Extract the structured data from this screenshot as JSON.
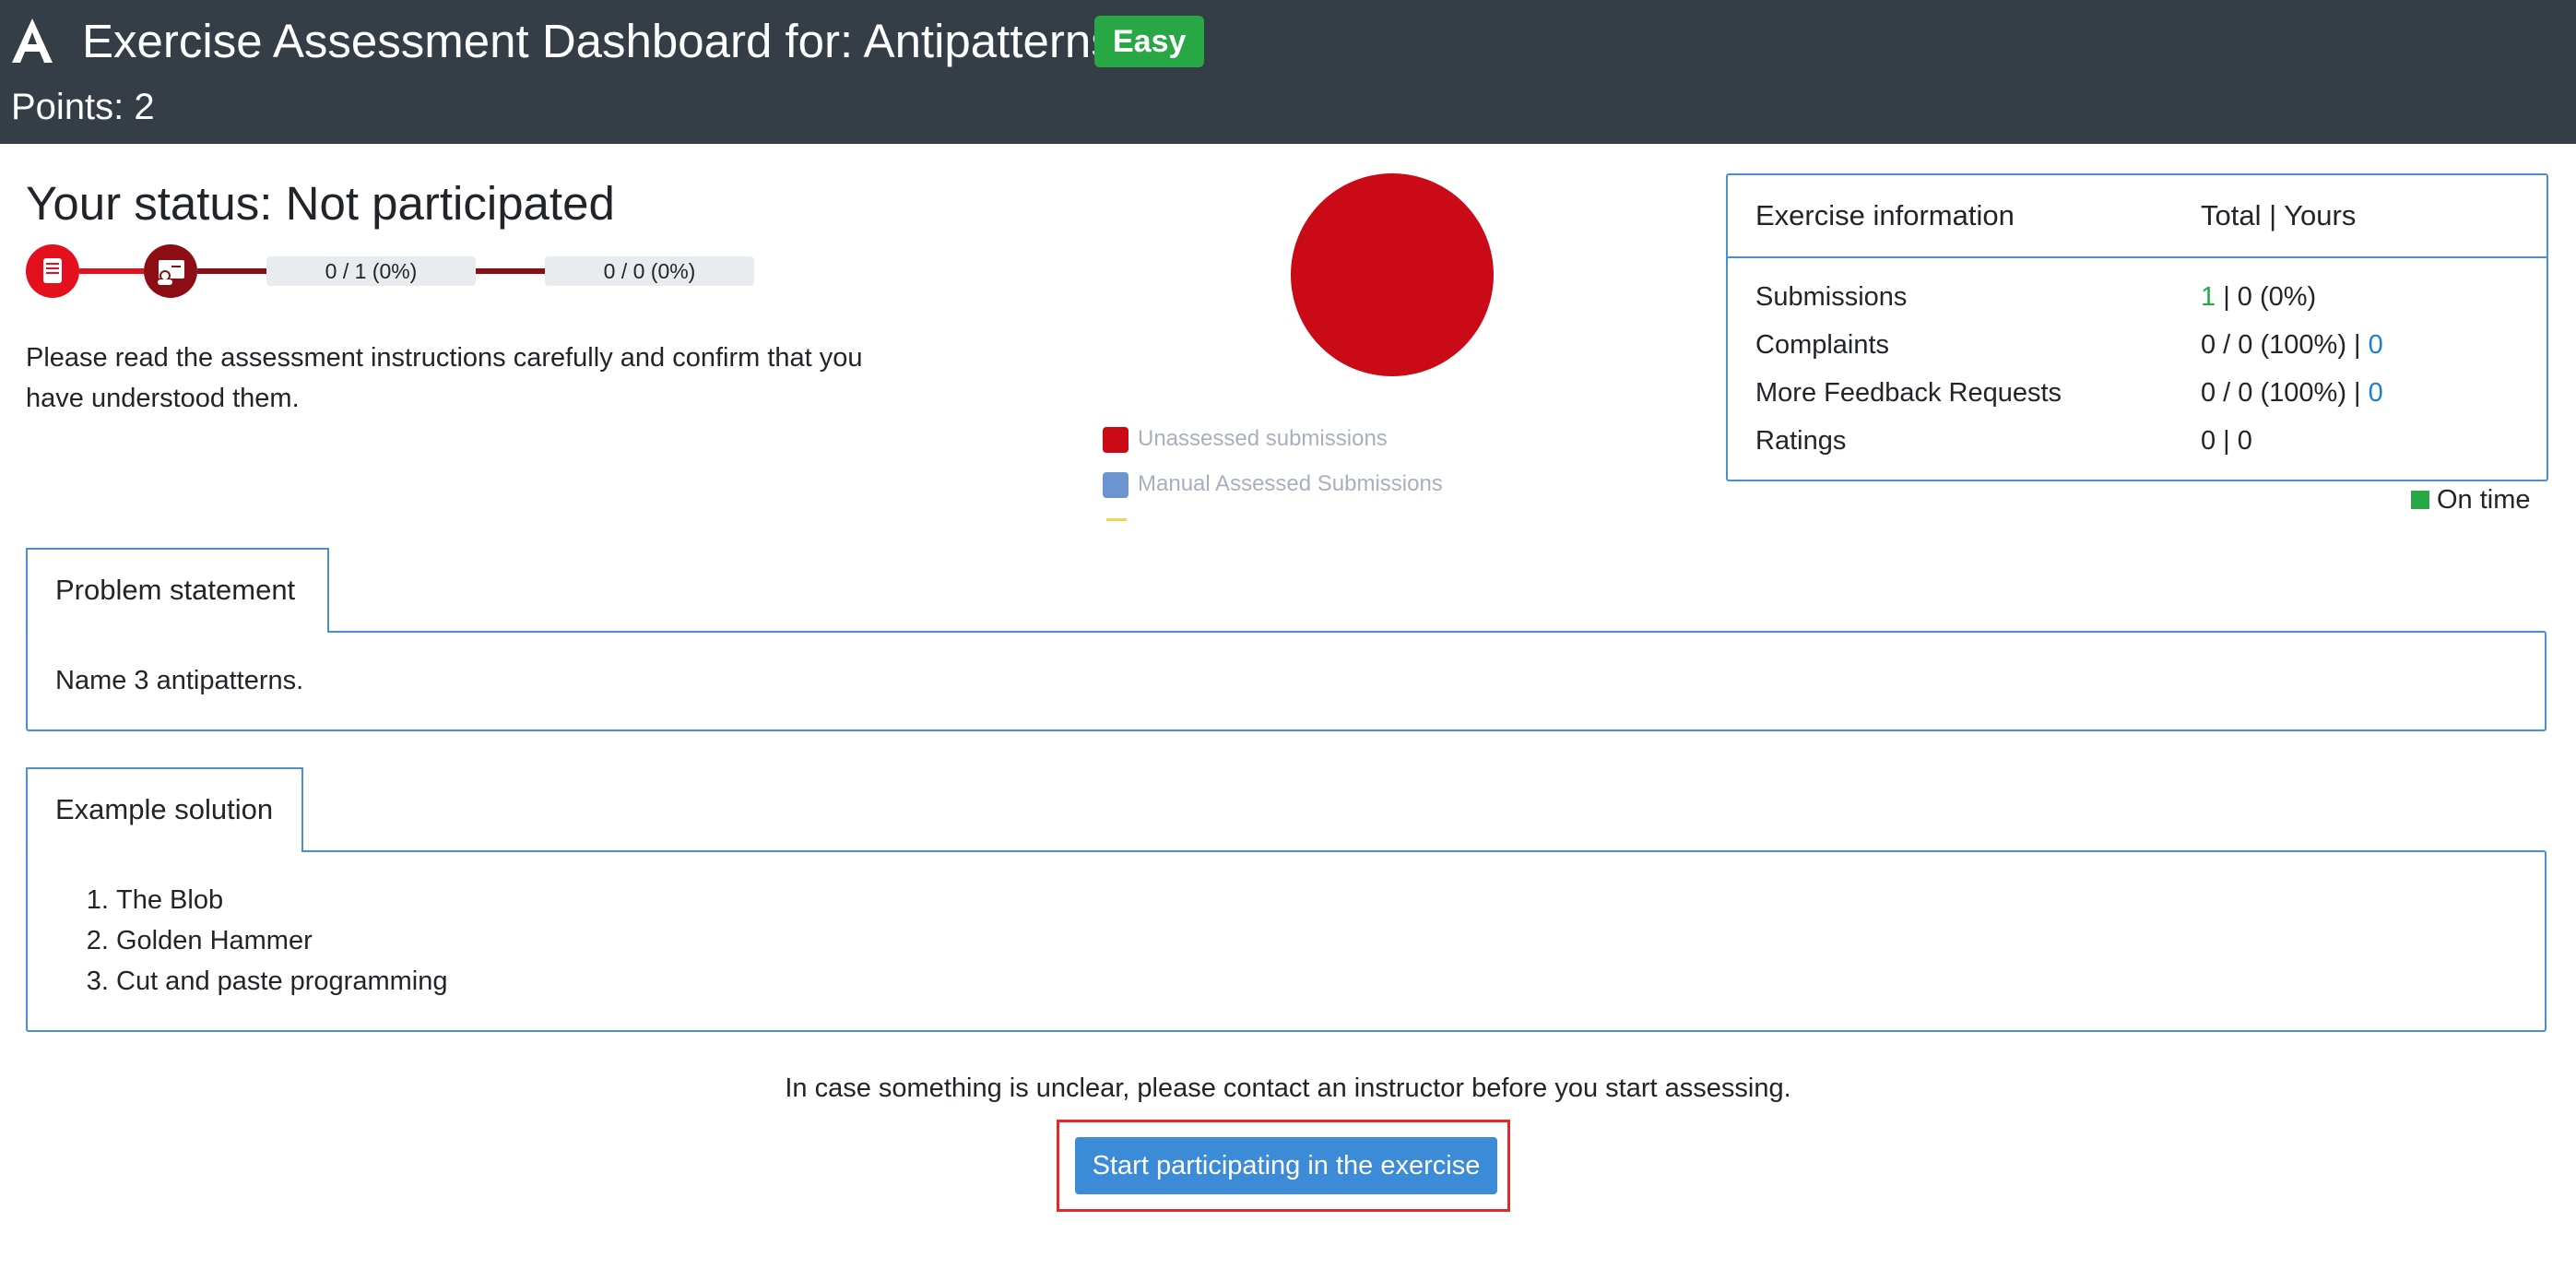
{
  "header": {
    "title": "Exercise Assessment Dashboard for: Antipatterns",
    "difficulty_badge": "Easy",
    "points": "Points: 2"
  },
  "status": {
    "title": "Your status: Not participated",
    "progress": [
      {
        "label": "0 / 1 (0%)"
      },
      {
        "label": "0 / 0 (0%)"
      }
    ],
    "instructions": "Please read the assessment instructions carefully and confirm that you have understood them."
  },
  "chart_data": {
    "type": "pie",
    "slices": [
      {
        "label": "Unassessed submissions",
        "value": 1,
        "color": "#ca0a17"
      },
      {
        "label": "Manual Assessed Submissions",
        "value": 0,
        "color": "#6c95cf"
      }
    ]
  },
  "legend": [
    {
      "label": "Unassessed submissions",
      "color": "#ca0a17"
    },
    {
      "label": "Manual Assessed Submissions",
      "color": "#6c95cf"
    }
  ],
  "exercise_info": {
    "title": "Exercise information",
    "column_header": "Total | Yours",
    "rows": [
      {
        "label": "Submissions",
        "highlight": "1",
        "rest": " | 0 (0%)",
        "link": ""
      },
      {
        "label": "Complaints",
        "highlight": "",
        "rest": "0 / 0 (100%) | ",
        "link": "0"
      },
      {
        "label": "More Feedback Requests",
        "highlight": "",
        "rest": "0 / 0 (100%) | ",
        "link": "0"
      },
      {
        "label": "Ratings",
        "highlight": "",
        "rest": "0 | 0",
        "link": ""
      }
    ],
    "on_time": "On time"
  },
  "problem_statement": {
    "tab_label": "Problem statement",
    "text": "Name 3 antipatterns."
  },
  "example_solution": {
    "tab_label": "Example solution",
    "items": [
      "The Blob",
      "Golden Hammer",
      "Cut and paste programming"
    ]
  },
  "footer": {
    "contact_text": "In case something is unclear, please contact an instructor before you start assessing.",
    "start_button_label": "Start participating in the exercise"
  },
  "colors": {
    "header_bg": "#353d47",
    "badge_green": "#28a745",
    "accent_blue": "#4a8fd6",
    "button_blue": "#3b8bd6",
    "step_red": "#e4101e",
    "step_dark_red": "#8c0d14",
    "highlight_frame": "#e32b2b"
  }
}
